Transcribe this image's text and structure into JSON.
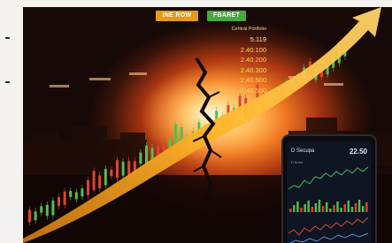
{
  "buttons": {
    "left_label": "INE ROW",
    "right_label": "FBARET"
  },
  "panel": {
    "title": "Central Portfolio",
    "values": [
      "5.119",
      "2.40.100",
      "2.40.200",
      "2.40.300",
      "2.40.500",
      "2.40.500"
    ]
  },
  "phone": {
    "brand": "D Secupa",
    "time": "22.50",
    "sub_label": "D Autol"
  },
  "colors": {
    "arrow": "#f6a81f",
    "candle_up": "#53c04a",
    "candle_down": "#e2452c",
    "glow": "#ffbf58"
  }
}
